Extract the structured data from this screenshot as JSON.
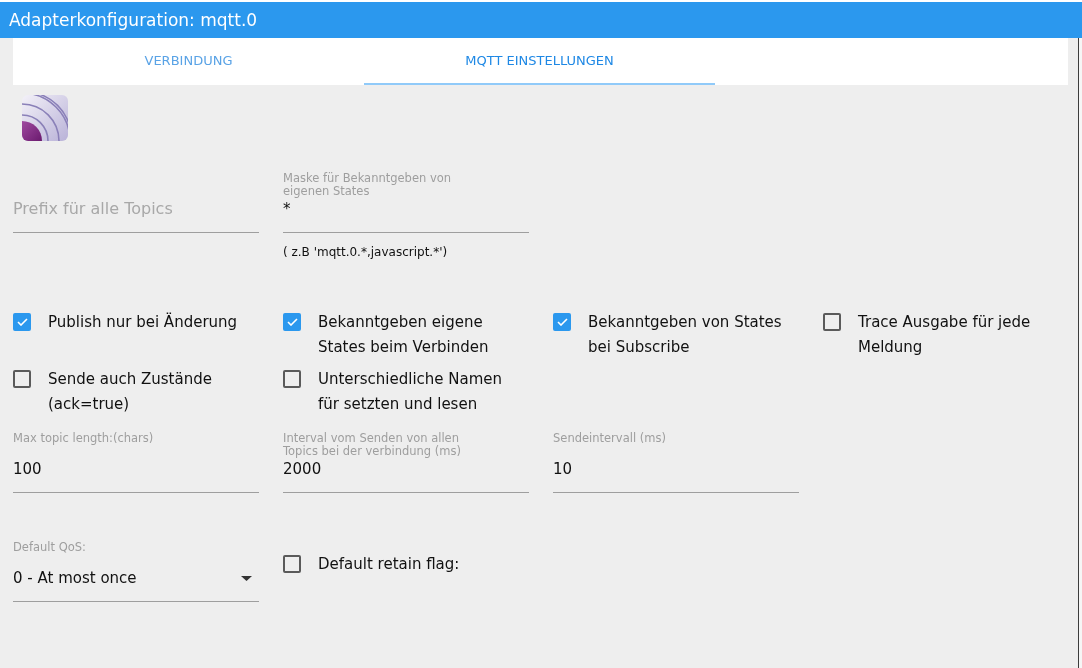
{
  "window": {
    "title": "Adapterkonfiguration: mqtt.0"
  },
  "tabs": [
    {
      "label": "VERBINDUNG",
      "selected": false
    },
    {
      "label": "MQTT EINSTELLUNGEN",
      "selected": true
    }
  ],
  "topic_fields": [
    {
      "placeholder": "Prefix für alle Topics"
    },
    {
      "label": "Maske für Bekanntgeben von eigenen States",
      "value": "*",
      "helper": "( z.B 'mqtt.0.*,javascript.*')"
    }
  ],
  "options": [
    {
      "label": "Publish nur bei Änderung",
      "checked": true
    },
    {
      "label": "Bekanntgeben eigene States beim Verbinden",
      "checked": true
    },
    {
      "label": "Bekanntgeben von States bei Subscribe",
      "checked": true
    },
    {
      "label": "Trace Ausgabe für jede Meldung",
      "checked": false
    },
    {
      "label": "Sende auch Zustände (ack=true)",
      "checked": false
    },
    {
      "label": "Unterschiedliche Namen für setzten und lesen",
      "checked": false
    }
  ],
  "number_fields": [
    {
      "label": "Max topic length:(chars)",
      "value": "100"
    },
    {
      "label": "Interval vom Senden von allen Topics bei der verbindung (ms)",
      "value": "2000"
    },
    {
      "label": "Sendeintervall (ms)",
      "value": "10"
    }
  ],
  "qos": {
    "label": "Default QoS:",
    "value": "0 - At most once"
  },
  "retain": {
    "label": "Default retain flag:",
    "checked": false
  }
}
